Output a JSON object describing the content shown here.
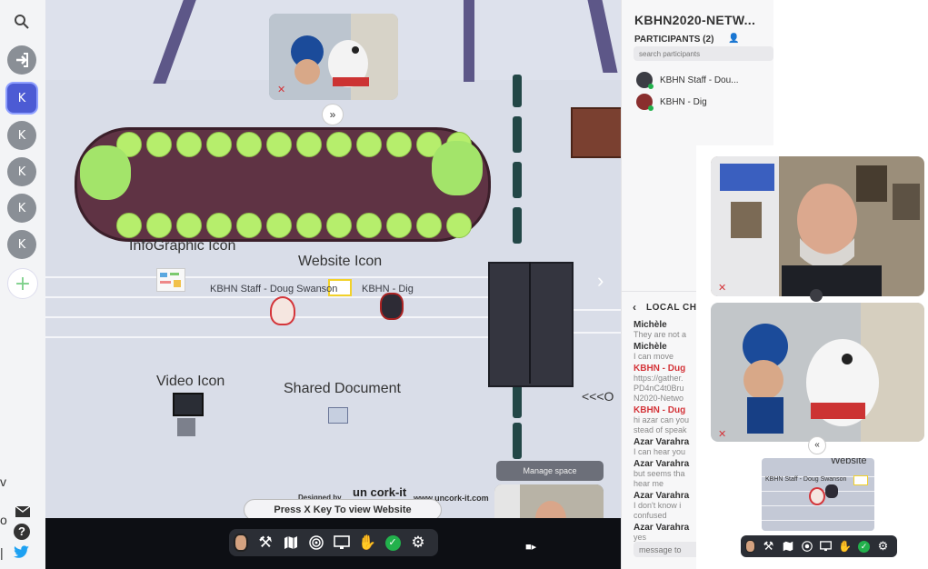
{
  "window": {
    "title": "KBHN2020-NETW..."
  },
  "sidebar": {
    "avatars": [
      "K",
      "K",
      "K",
      "K",
      "K"
    ],
    "add_label": "+"
  },
  "map": {
    "labels": {
      "infographic": "InfoGraphic Icon",
      "website": "Website Icon",
      "video": "Video Icon",
      "shared_doc": "Shared Document",
      "arrow_text": "<<<O"
    },
    "players": {
      "doug": "KBHN Staff - Doug Swanson",
      "dig": "KBHN - Dig"
    },
    "designed_by": "Designed by",
    "uncork_logo": "un cork-it",
    "uncork_url": "www.uncork-it.com"
  },
  "manage_space": "Manage space",
  "press_hint": "Press X Key To view Website",
  "panel": {
    "title": "KBHN2020-NETW...",
    "participants_label": "PARTICIPANTS (2)",
    "search_placeholder": "search participants",
    "participants": [
      "KBHN Staff - Dou...",
      "KBHN - Dig"
    ],
    "chat_header": "LOCAL CH",
    "messages": [
      {
        "name": "Michèle",
        "text": "They are not a",
        "red": false
      },
      {
        "name": "Michèle",
        "text": "I can move",
        "red": false
      },
      {
        "name": "KBHN - Dug",
        "text": "https://gather.\nPD4nC4t0Bru\nN2020-Netwo",
        "red": true
      },
      {
        "name": "KBHN - Dug",
        "text": "hi azar can you\nstead of speak",
        "red": true
      },
      {
        "name": "Azar Varahra",
        "text": "I can hear you",
        "red": false
      },
      {
        "name": "Azar Varahra",
        "text": "but seems tha\nhear me",
        "red": false
      },
      {
        "name": "Azar Varahra",
        "text": "I don't know i\nconfused",
        "red": false
      },
      {
        "name": "Azar Varahra",
        "text": "yes",
        "red": false
      }
    ],
    "message_placeholder": "message to"
  },
  "popout": {
    "minimap_label": "Website",
    "minimap_player": "KBHN Staff - Doug Swanson"
  },
  "left_fragments": {
    "a": "v",
    "b": "o",
    "c": "|"
  },
  "colors": {
    "accent": "#4c5bd4",
    "green": "#22b14c",
    "red": "#d4353a",
    "chat_red": "#d4353a"
  }
}
